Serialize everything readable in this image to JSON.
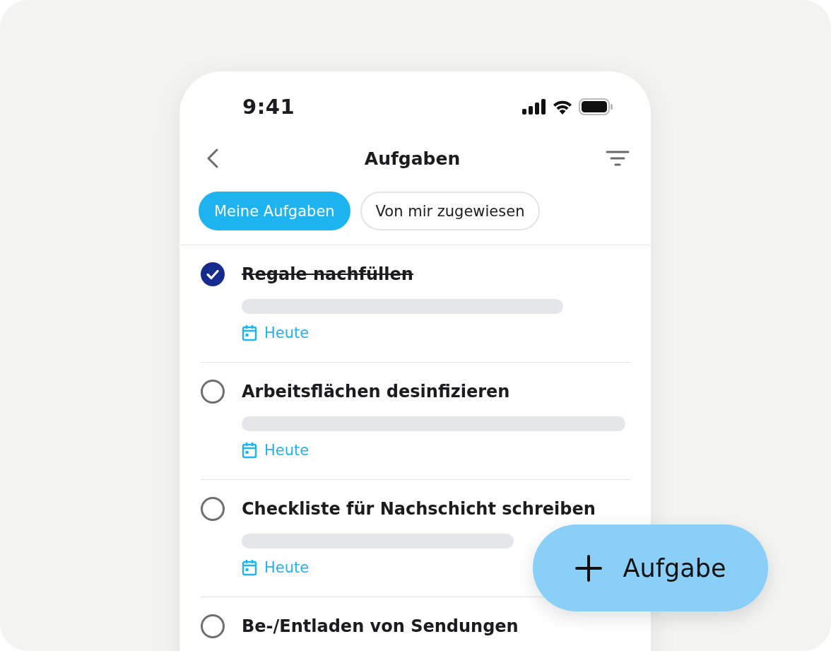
{
  "status_bar": {
    "time": "9:41"
  },
  "header": {
    "title": "Aufgaben"
  },
  "tabs": [
    {
      "label": "Meine Aufgaben",
      "selected": true
    },
    {
      "label": "Von mir zugewiesen",
      "selected": false
    }
  ],
  "tasks": [
    {
      "title": "Regale nachfüllen",
      "checked": true,
      "due": "Heute"
    },
    {
      "title": "Arbeitsflächen desinfizieren",
      "checked": false,
      "due": "Heute"
    },
    {
      "title": "Checkliste für Nachschicht schreiben",
      "checked": false,
      "due": "Heute"
    },
    {
      "title": "Be-/Entladen von Sendungen",
      "checked": false
    }
  ],
  "fab": {
    "label": "Aufgabe"
  }
}
